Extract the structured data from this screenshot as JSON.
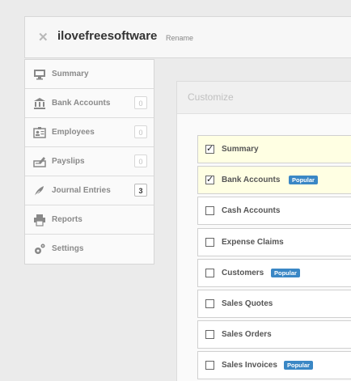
{
  "header": {
    "close_icon": "close-icon",
    "title": "ilovefreesoftware",
    "rename": "Rename"
  },
  "sidebar": {
    "items": [
      {
        "label": "Summary",
        "icon": "monitor-icon",
        "count": null
      },
      {
        "label": "Bank Accounts",
        "icon": "bank-icon",
        "count": "0"
      },
      {
        "label": "Employees",
        "icon": "id-card-icon",
        "count": "0"
      },
      {
        "label": "Payslips",
        "icon": "payslip-icon",
        "count": "0"
      },
      {
        "label": "Journal Entries",
        "icon": "pen-icon",
        "count": "3"
      },
      {
        "label": "Reports",
        "icon": "printer-icon",
        "count": null
      },
      {
        "label": "Settings",
        "icon": "gear-icon",
        "count": null
      }
    ]
  },
  "customize": {
    "title": "Customize",
    "items": [
      {
        "label": "Summary",
        "checked": true,
        "badge": ""
      },
      {
        "label": "Bank Accounts",
        "checked": true,
        "badge": "Popular"
      },
      {
        "label": "Cash Accounts",
        "checked": false,
        "badge": ""
      },
      {
        "label": "Expense Claims",
        "checked": false,
        "badge": ""
      },
      {
        "label": "Customers",
        "checked": false,
        "badge": "Popular"
      },
      {
        "label": "Sales Quotes",
        "checked": false,
        "badge": ""
      },
      {
        "label": "Sales Orders",
        "checked": false,
        "badge": ""
      },
      {
        "label": "Sales Invoices",
        "checked": false,
        "badge": "Popular"
      }
    ]
  },
  "colors": {
    "badge": "#3a87c5",
    "checked_row": "#ffffe3"
  }
}
